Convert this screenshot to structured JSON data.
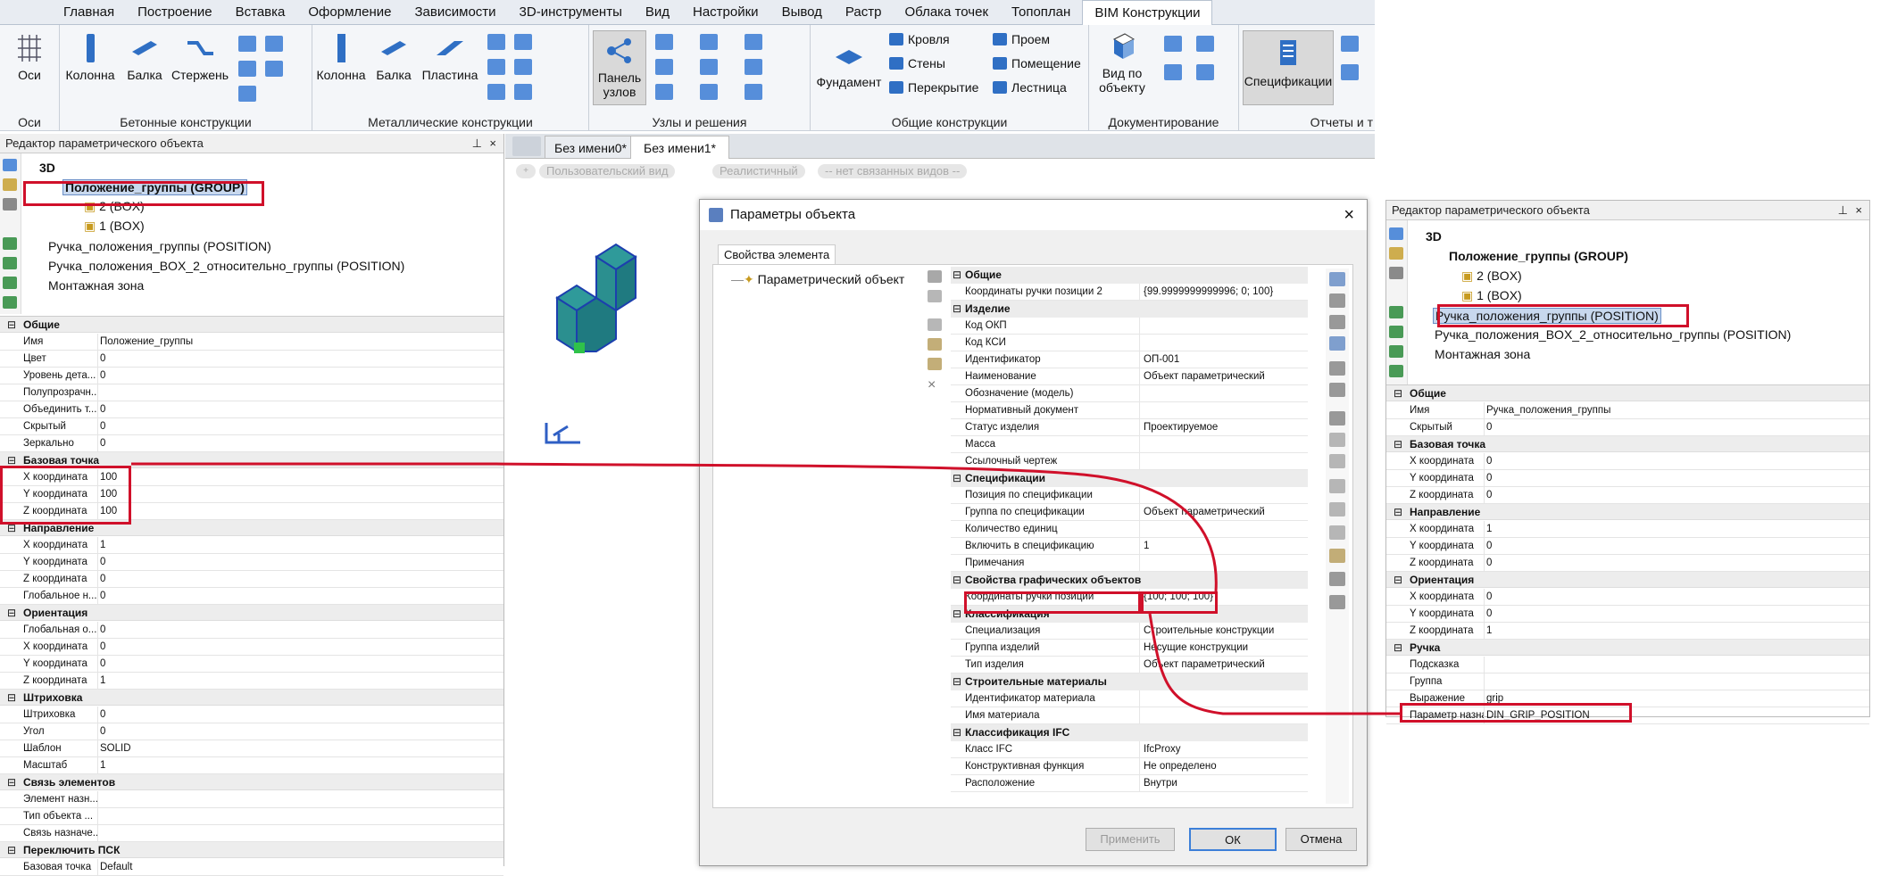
{
  "ribbon": {
    "tabs": [
      "Главная",
      "Построение",
      "Вставка",
      "Оформление",
      "Зависимости",
      "3D-инструменты",
      "Вид",
      "Настройки",
      "Вывод",
      "Растр",
      "Облака точек",
      "Топоплан",
      "BIM Конструкции"
    ],
    "active_tab": "BIM Конструкции",
    "groups": {
      "axes": {
        "label": "Оси",
        "button": "Оси"
      },
      "concrete": {
        "label": "Бетонные конструкции",
        "buttons": [
          "Колонна",
          "Балка",
          "Стержень"
        ]
      },
      "metal": {
        "label": "Металлические конструкции",
        "buttons": [
          "Колонна",
          "Балка",
          "Пластина"
        ]
      },
      "nodes": {
        "label": "Узлы и решения",
        "button_line1": "Панель",
        "button_line2": "узлов"
      },
      "general": {
        "label": "Общие конструкции",
        "big": "Фундамент",
        "items": [
          "Кровля",
          "Стены",
          "Перекрытие",
          "Проем",
          "Помещение",
          "Лестница"
        ]
      },
      "docs": {
        "label": "Документирование",
        "button_line1": "Вид по",
        "button_line2": "объекту"
      },
      "reports": {
        "label": "Отчеты и т",
        "button": "Спецификации"
      }
    }
  },
  "left_panel": {
    "title": "Редактор параметрического объекта",
    "tree": [
      "3D",
      "Положение_группы (GROUP)",
      "2 (BOX)",
      "1 (BOX)",
      "Ручка_положения_группы (POSITION)",
      "Ручка_положения_BOX_2_относительно_группы (POSITION)",
      "Монтажная зона"
    ],
    "sections": [
      {
        "name": "Общие",
        "rows": [
          [
            "Имя",
            "Положение_группы"
          ],
          [
            "Цвет",
            "0"
          ],
          [
            "Уровень дета...",
            "0"
          ],
          [
            "Полупрозрачн...",
            ""
          ],
          [
            "Объединить т...",
            "0"
          ],
          [
            "Скрытый",
            "0"
          ],
          [
            "Зеркально",
            "0"
          ]
        ]
      },
      {
        "name": "Базовая точка",
        "rows": [
          [
            "X координата",
            "100"
          ],
          [
            "Y координата",
            "100"
          ],
          [
            "Z координата",
            "100"
          ]
        ]
      },
      {
        "name": "Направление",
        "rows": [
          [
            "X координата",
            "1"
          ],
          [
            "Y координата",
            "0"
          ],
          [
            "Z координата",
            "0"
          ],
          [
            "Глобальное н...",
            "0"
          ]
        ]
      },
      {
        "name": "Ориентация",
        "rows": [
          [
            "Глобальная о...",
            "0"
          ],
          [
            "X координата",
            "0"
          ],
          [
            "Y координата",
            "0"
          ],
          [
            "Z координата",
            "1"
          ]
        ]
      },
      {
        "name": "Штриховка",
        "rows": [
          [
            "Штриховка",
            "0"
          ],
          [
            "Угол",
            "0"
          ],
          [
            "Шаблон",
            "SOLID"
          ],
          [
            "Масштаб",
            "1"
          ]
        ]
      },
      {
        "name": "Связь элементов",
        "rows": [
          [
            "Элемент назн...",
            ""
          ],
          [
            "Тип объекта ...",
            ""
          ],
          [
            "Связь назначе...",
            ""
          ]
        ]
      },
      {
        "name": "Переключить ПСК",
        "rows": [
          [
            "Базовая точка",
            "Default"
          ]
        ]
      }
    ]
  },
  "doc_tabs": [
    "Без имени0*",
    "Без имени1*"
  ],
  "viewport_bar": [
    "Пользовательский вид",
    "Реалистичный",
    "-- нет связанных видов --"
  ],
  "dialog": {
    "title": "Параметры объекта",
    "tab": "Свойства элемента",
    "tree_item": "Параметрический объект",
    "sections": [
      {
        "name": "Общие",
        "rows": [
          [
            "Координаты ручки позиции 2",
            "{99.9999999999996; 0; 100}"
          ]
        ]
      },
      {
        "name": "Изделие",
        "rows": [
          [
            "Код ОКП",
            ""
          ],
          [
            "Код КСИ",
            ""
          ],
          [
            "Идентификатор",
            "ОП-001"
          ],
          [
            "Наименование",
            "Объект параметрический"
          ],
          [
            "Обозначение (модель)",
            ""
          ],
          [
            "Нормативный документ",
            ""
          ],
          [
            "Статус изделия",
            "Проектируемое"
          ],
          [
            "Масса",
            ""
          ],
          [
            "Ссылочный чертеж",
            ""
          ]
        ]
      },
      {
        "name": "Спецификации",
        "rows": [
          [
            "Позиция по спецификации",
            ""
          ],
          [
            "Группа по спецификации",
            "Объект параметрический"
          ],
          [
            "Количество единиц",
            ""
          ],
          [
            "Включить в спецификацию",
            "1"
          ],
          [
            "Примечания",
            ""
          ]
        ]
      },
      {
        "name": "Свойства графических объектов",
        "rows": [
          [
            "Координаты ручки позиции",
            "{100; 100; 100}"
          ]
        ]
      },
      {
        "name": "Классификация",
        "rows": [
          [
            "Специализация",
            "Строительные конструкции"
          ],
          [
            "Группа изделий",
            "Несущие конструкции"
          ],
          [
            "Тип изделия",
            "Объект параметрический"
          ]
        ]
      },
      {
        "name": "Строительные материалы",
        "rows": [
          [
            "Идентификатор материала",
            ""
          ],
          [
            "Имя материала",
            ""
          ]
        ]
      },
      {
        "name": "Классификация IFC",
        "rows": [
          [
            "Класс IFC",
            "IfcProxy"
          ],
          [
            "Конструктивная функция",
            "Не определено"
          ],
          [
            "Расположение",
            "Внутри"
          ]
        ]
      }
    ],
    "buttons": {
      "apply": "Применить",
      "ok": "ОК",
      "cancel": "Отмена"
    }
  },
  "right_panel": {
    "title": "Редактор параметрического объекта",
    "tree": [
      "3D",
      "Положение_группы (GROUP)",
      "2 (BOX)",
      "1 (BOX)",
      "Ручка_положения_группы (POSITION)",
      "Ручка_положения_BOX_2_относительно_группы (POSITION)",
      "Монтажная зона"
    ],
    "sections": [
      {
        "name": "Общие",
        "rows": [
          [
            "Имя",
            "Ручка_положения_группы"
          ],
          [
            "Скрытый",
            "0"
          ]
        ]
      },
      {
        "name": "Базовая точка",
        "rows": [
          [
            "X координата",
            "0"
          ],
          [
            "Y координата",
            "0"
          ],
          [
            "Z координата",
            "0"
          ]
        ]
      },
      {
        "name": "Направление",
        "rows": [
          [
            "X координата",
            "1"
          ],
          [
            "Y координата",
            "0"
          ],
          [
            "Z координата",
            "0"
          ]
        ]
      },
      {
        "name": "Ориентация",
        "rows": [
          [
            "X координата",
            "0"
          ],
          [
            "Y координата",
            "0"
          ],
          [
            "Z координата",
            "1"
          ]
        ]
      },
      {
        "name": "Ручка",
        "rows": [
          [
            "Подсказка",
            ""
          ],
          [
            "Группа",
            ""
          ],
          [
            "Выражение",
            "grip"
          ],
          [
            "Параметр назначения",
            "DIN_GRIP_POSITION"
          ]
        ]
      }
    ]
  }
}
